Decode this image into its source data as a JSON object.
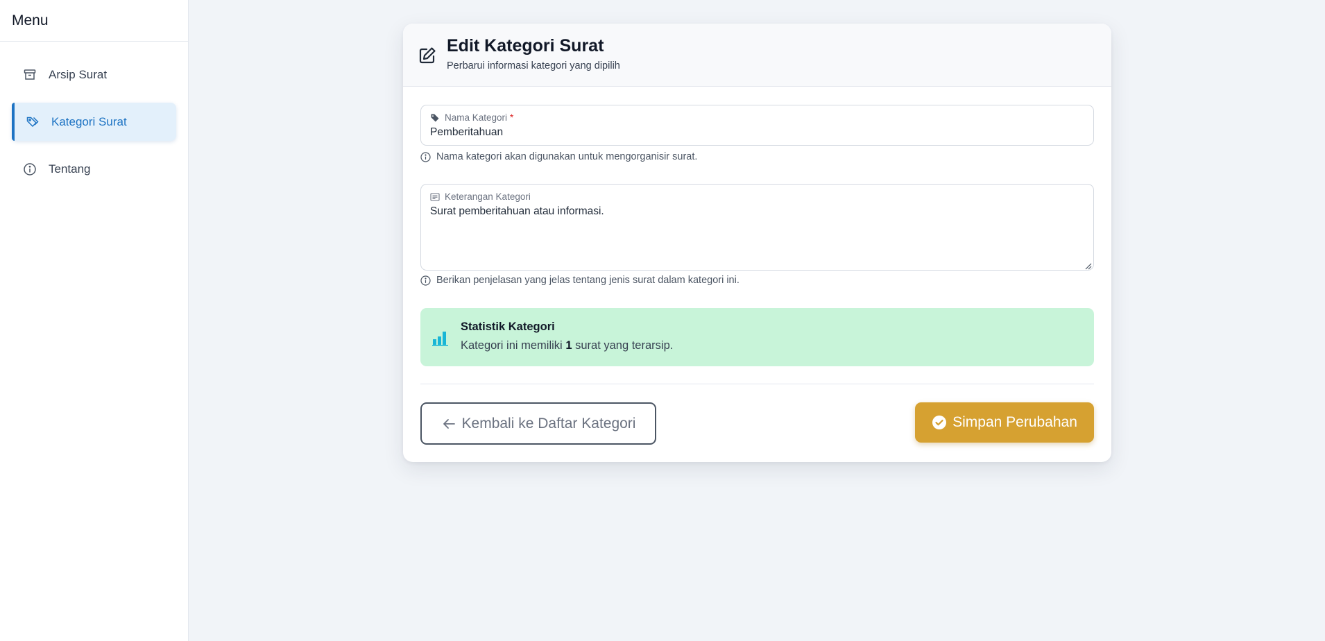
{
  "sidebar": {
    "title": "Menu",
    "items": [
      {
        "label": "Arsip Surat",
        "icon": "archive-icon",
        "active": false
      },
      {
        "label": "Kategori Surat",
        "icon": "tag-icon",
        "active": true
      },
      {
        "label": "Tentang",
        "icon": "info-icon",
        "active": false
      }
    ]
  },
  "card": {
    "title": "Edit Kategori Surat",
    "subtitle": "Perbarui informasi kategori yang dipilih",
    "header_icon": "edit-icon"
  },
  "form": {
    "name": {
      "label": "Nama Kategori",
      "required_mark": "*",
      "value": "Pemberitahuan",
      "icon": "tag-icon",
      "help": "Nama kategori akan digunakan untuk mengorganisir surat."
    },
    "description": {
      "label": "Keterangan Kategori",
      "value": "Surat pemberitahuan atau informasi.",
      "icon": "text-icon",
      "help": "Berikan penjelasan yang jelas tentang jenis surat dalam kategori ini."
    }
  },
  "stats": {
    "title": "Statistik Kategori",
    "text_before": "Kategori ini memiliki",
    "count": "1",
    "text_after": "surat yang terarsip.",
    "icon": "bar-chart-icon"
  },
  "actions": {
    "back_label": "Kembali ke Daftar Kategori",
    "save_label": "Simpan Perubahan"
  },
  "colors": {
    "accent": "#1d73c3",
    "save_button": "#d6a131",
    "stats_bg": "#c8f4d9",
    "stats_icon": "#19b6d6",
    "required": "#dc2626"
  }
}
